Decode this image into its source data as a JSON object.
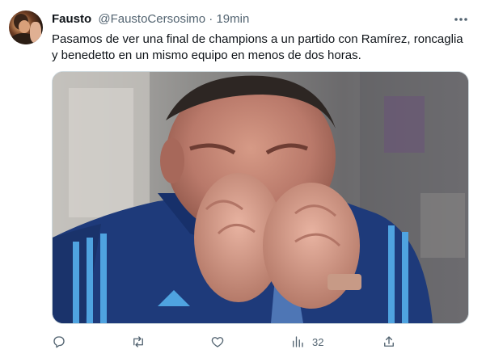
{
  "tweet": {
    "name": "Fausto",
    "handle": "@FaustoCersosimo",
    "separator": "·",
    "time": "19min",
    "text": "Pasamos de ver una final de champions a un partido con Ramírez, roncaglia y benedetto en un mismo equipo en menos de dos horas.",
    "more_icon": "more-dots-icon",
    "avatar_icon": "profile-photo"
  },
  "actions": {
    "reply_icon": "reply-icon",
    "retweet_icon": "retweet-icon",
    "like_icon": "like-icon",
    "views_icon": "views-icon",
    "views_count": "32",
    "share_icon": "share-icon"
  },
  "colors": {
    "text": "#0f1419",
    "muted": "#536471",
    "border": "#cfd9de",
    "jersey": "#1e3a7a",
    "jersey_stripe": "#4fa3e0"
  }
}
